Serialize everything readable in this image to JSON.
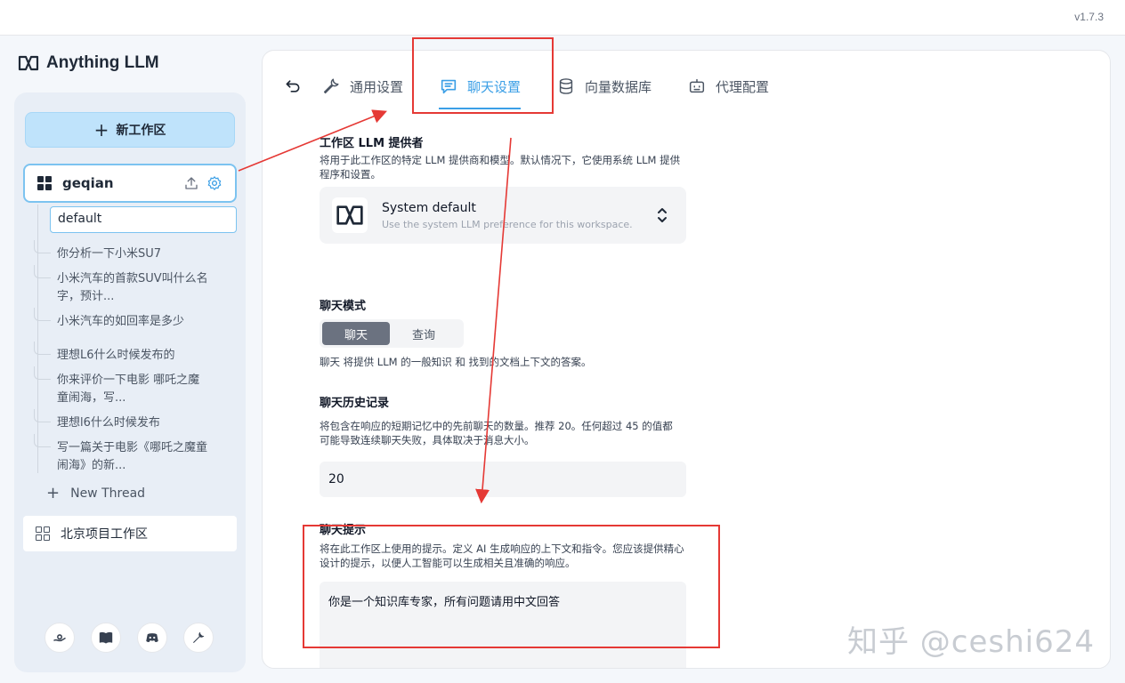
{
  "window": {
    "version": "v1.7.3"
  },
  "brand": {
    "name": "Anything LLM"
  },
  "sidebar": {
    "new_workspace_label": "新工作区",
    "active_workspace": {
      "name": "geqian"
    },
    "threads": [
      {
        "label": "default"
      },
      {
        "label": "你分析一下小米SU7"
      },
      {
        "label": "小米汽车的首款SUV叫什么名字，预计..."
      },
      {
        "label": "小米汽车的如回率是多少"
      },
      {
        "label": "理想L6什么时候发布的"
      },
      {
        "label": "你来评价一下电影 哪吒之魔童闹海，写..."
      },
      {
        "label": "理想l6什么时候发布"
      },
      {
        "label": "写一篇关于电影《哪吒之魔童闹海》的新..."
      }
    ],
    "new_thread_label": "New Thread",
    "other_workspace": {
      "name": "北京项目工作区"
    },
    "footer_icons": [
      "community-hub-icon",
      "docs-book-icon",
      "discord-icon",
      "settings-wrench-icon"
    ]
  },
  "tabs": [
    {
      "label": "通用设置",
      "icon": "wrench-icon",
      "active": false
    },
    {
      "label": "聊天设置",
      "icon": "chat-icon",
      "active": true
    },
    {
      "label": "向量数据库",
      "icon": "database-icon",
      "active": false
    },
    {
      "label": "代理配置",
      "icon": "robot-icon",
      "active": false
    }
  ],
  "settings": {
    "llm_provider": {
      "title": "工作区 LLM 提供者",
      "desc": "将用于此工作区的特定 LLM 提供商和模型。默认情况下，它使用系统 LLM 提供程序和设置。",
      "selected_title": "System default",
      "selected_desc": "Use the system LLM preference for this workspace."
    },
    "chat_mode": {
      "title": "聊天模式",
      "options": [
        "聊天",
        "查询"
      ],
      "selected": "聊天",
      "desc": "聊天 将提供 LLM 的一般知识 和 找到的文档上下文的答案。"
    },
    "chat_history": {
      "title": "聊天历史记录",
      "desc": "将包含在响应的短期记忆中的先前聊天的数量。推荐 20。任何超过 45 的值都可能导致连续聊天失败，具体取决于消息大小。",
      "value": "20"
    },
    "chat_prompt": {
      "title": "聊天提示",
      "desc": "将在此工作区上使用的提示。定义 AI 生成响应的上下文和指令。您应该提供精心设计的提示，以便人工智能可以生成相关且准确的响应。",
      "value": "你是一个知识库专家，所有问题请用中文回答"
    }
  },
  "watermark": "知乎 @ceshi624",
  "annotation_color": "#e53935",
  "accent_color": "#3b9fe6"
}
